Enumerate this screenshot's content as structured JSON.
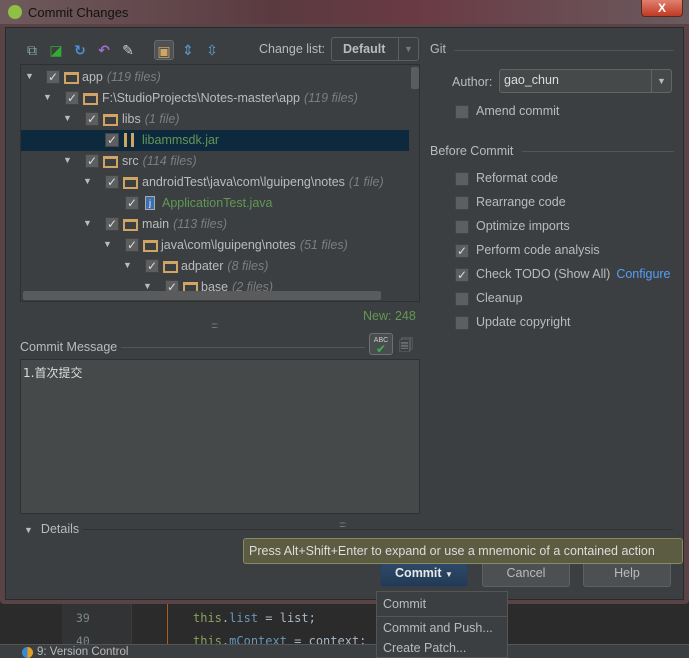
{
  "window": {
    "title": "Commit Changes",
    "close_label": "X"
  },
  "toolbar": {
    "icons": [
      "diff-icon",
      "jump-to-source-icon",
      "refresh-icon",
      "rollback-icon",
      "edit-source-icon",
      "group-by-directory-icon",
      "expand-all-icon",
      "collapse-all-icon"
    ],
    "change_list_label": "Change list:",
    "change_list_value": "Default"
  },
  "tree": {
    "rows": [
      {
        "name": "app",
        "count": "(119 files)",
        "type": "module",
        "depth": 0
      },
      {
        "name": "F:\\StudioProjects\\Notes-master\\app",
        "count": "(119 files)",
        "type": "folder",
        "depth": 1
      },
      {
        "name": "libs",
        "count": "(1 file)",
        "type": "folder",
        "depth": 2
      },
      {
        "name": "libammsdk.jar",
        "count": "",
        "type": "jar",
        "depth": 3,
        "selected": true,
        "status": "new"
      },
      {
        "name": "src",
        "count": "(114 files)",
        "type": "folder",
        "depth": 2
      },
      {
        "name": "androidTest\\java\\com\\lguipeng\\notes",
        "count": "(1 file)",
        "type": "folder",
        "depth": 3
      },
      {
        "name": "ApplicationTest.java",
        "count": "",
        "type": "java",
        "depth": 4,
        "status": "new"
      },
      {
        "name": "main",
        "count": "(113 files)",
        "type": "folder",
        "depth": 3
      },
      {
        "name": "java\\com\\lguipeng\\notes",
        "count": "(51 files)",
        "type": "folder",
        "depth": 4
      },
      {
        "name": "adpater",
        "count": "(8 files)",
        "type": "folder",
        "depth": 5
      },
      {
        "name": "base",
        "count": "(2 files)",
        "type": "folder",
        "depth": 6
      }
    ],
    "new_count": "New: 248"
  },
  "git": {
    "section_label": "Git",
    "author_label": "Author:",
    "author_value": "gao_chun",
    "amend_label": "Amend commit",
    "amend_checked": false
  },
  "before_commit": {
    "label": "Before Commit",
    "options": [
      {
        "label": "Reformat code",
        "checked": false
      },
      {
        "label": "Rearrange code",
        "checked": false
      },
      {
        "label": "Optimize imports",
        "checked": false
      },
      {
        "label": "Perform code analysis",
        "checked": true
      },
      {
        "label": "Check TODO (Show All)",
        "checked": true,
        "link": "Configure"
      },
      {
        "label": "Cleanup",
        "checked": false
      },
      {
        "label": "Update copyright",
        "checked": false
      }
    ]
  },
  "commit_message": {
    "label": "Commit Message",
    "value": "1.首次提交",
    "spell_check_label": "ABC"
  },
  "details": {
    "label": "Details"
  },
  "buttons": {
    "commit": "Commit",
    "cancel": "Cancel",
    "help": "Help"
  },
  "tooltip": "Press Alt+Shift+Enter to expand or use a mnemonic of a contained action",
  "popup_menu": {
    "items": [
      "Commit",
      "Commit and Push...",
      "Create Patch..."
    ]
  },
  "editor": {
    "lines": [
      {
        "num": "39",
        "kw": "this",
        "field": "list",
        "rest": " = list;"
      },
      {
        "num": "40",
        "kw": "this",
        "field": "mContext",
        "rest": " = context;"
      }
    ]
  },
  "statusbar": {
    "version_control": "9: Version Control"
  }
}
